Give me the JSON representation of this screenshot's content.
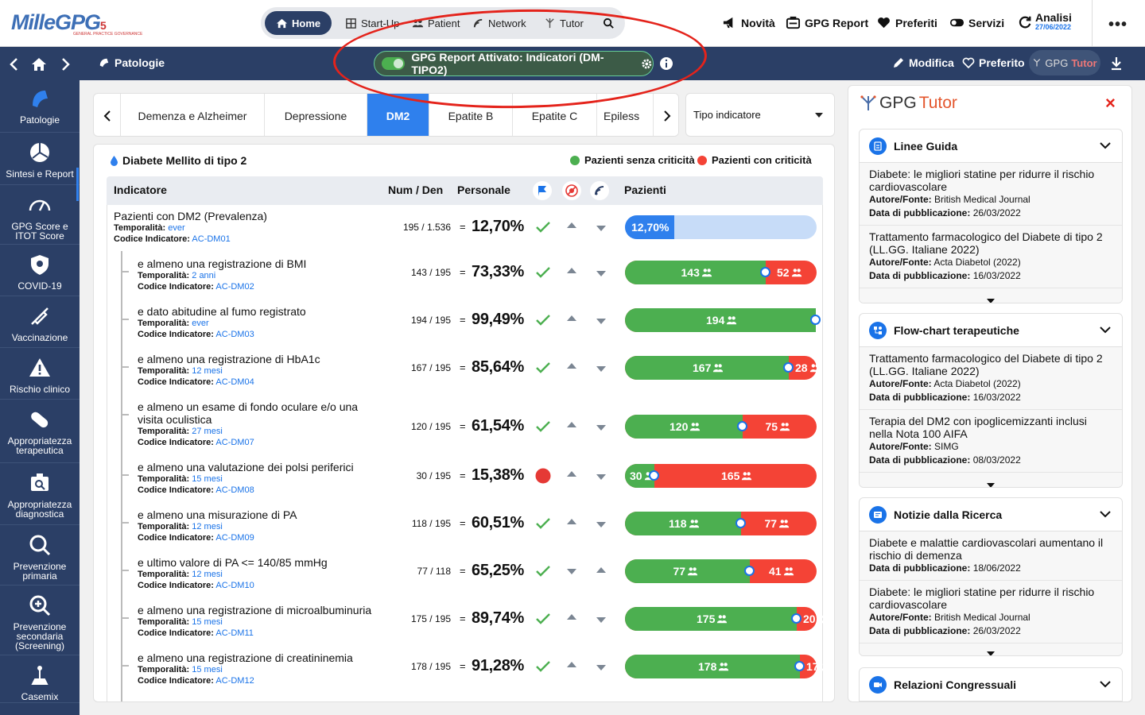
{
  "app": {
    "logo_text": "MilleGPG",
    "logo_sub": "GENERAL PRACTICE GOVERNANCE",
    "logo_badge": "5"
  },
  "topnav": {
    "tabs": [
      {
        "label": "Home",
        "icon": "home-icon",
        "active": true
      },
      {
        "label": "Start-Up",
        "icon": "grid-icon"
      },
      {
        "label": "Patient",
        "icon": "users-icon"
      },
      {
        "label": "Network",
        "icon": "network-icon"
      },
      {
        "label": "Tutor",
        "icon": "tutor-icon"
      }
    ],
    "search_icon": "search-icon",
    "right": [
      {
        "label": "Novità",
        "icon": "megaphone-icon"
      },
      {
        "label": "GPG Report",
        "icon": "report-icon"
      },
      {
        "label": "Preferiti",
        "icon": "heart-icon"
      },
      {
        "label": "Servizi",
        "icon": "toggle-icon"
      }
    ],
    "analisi": {
      "label": "Analisi",
      "date": "27/06/2022"
    },
    "more_label": "•••"
  },
  "secbar": {
    "section": "Patologie",
    "report_pill": "GPG Report Attivato: Indicatori (DM-TIPO2)",
    "report_enabled": true,
    "modifica": "Modifica",
    "preferito": "Preferito",
    "tutor_gpg": "GPG",
    "tutor_name": "Tutor"
  },
  "sidebar": {
    "items": [
      {
        "label": "Patologie",
        "icon": "patologie-icon",
        "active": true
      },
      {
        "label": "Sintesi e Report",
        "icon": "pie-chart-icon"
      },
      {
        "label": "GPG Score e ITOT Score",
        "icon": "gauge-icon"
      },
      {
        "label": "COVID-19",
        "icon": "shield-icon"
      },
      {
        "label": "Vaccinazione",
        "icon": "syringe-icon"
      },
      {
        "label": "Rischio clinico",
        "icon": "warning-icon"
      },
      {
        "label": "Appropriatezza terapeutica",
        "icon": "pill-icon"
      },
      {
        "label": "Appropriatezza diagnostica",
        "icon": "diagnostic-icon"
      },
      {
        "label": "Prevenzione primaria",
        "icon": "magnifier-icon"
      },
      {
        "label": "Prevenzione secondaria (Screening)",
        "icon": "zoom-plus-icon"
      },
      {
        "label": "Casemix",
        "icon": "scale-icon"
      }
    ]
  },
  "disease_tabs": {
    "items": [
      "Demenza e Alzheimer",
      "Depressione",
      "DM2",
      "Epatite B",
      "Epatite C",
      "Epiless"
    ],
    "active": "DM2",
    "filter_label": "Tipo indicatore"
  },
  "panel": {
    "title": "Diabete Mellito di tipo 2",
    "legend_ok": "Pazienti senza criticità",
    "legend_ko": "Pazienti con criticità",
    "colors": {
      "ok": "#4caf50",
      "ko": "#f44336",
      "accent": "#2f80ed"
    },
    "headers": {
      "indicatore": "Indicatore",
      "numden": "Num / Den",
      "personale": "Personale",
      "pazienti": "Pazienti",
      "icon1": "flag-icon",
      "icon2": "no-virus-icon",
      "icon3": "network-badge-icon"
    },
    "lbl_temporalita": "Temporalità:",
    "lbl_codice": "Codice Indicatore:",
    "eq": "=",
    "rows": [
      {
        "name": "Pazienti con DM2 (Prevalenza)",
        "temporalita": "ever",
        "codice": "AC-DM01",
        "num": "195",
        "den": "1.536",
        "frac": "195 / 1.536",
        "pct": "12,70%",
        "status": "check",
        "trend": "up-down",
        "type": "prevalence",
        "fill": 0.127
      },
      {
        "name": "e almeno una registrazione di BMI",
        "temporalita": "2 anni",
        "codice": "AC-DM02",
        "frac": "143 / 195",
        "pct": "73,33%",
        "status": "check",
        "trend": "up-down",
        "ok": "143",
        "ko": "52",
        "fill": 0.7333
      },
      {
        "name": "e dato abitudine al fumo registrato",
        "temporalita": "ever",
        "codice": "AC-DM03",
        "frac": "194 / 195",
        "pct": "99,49%",
        "status": "check",
        "trend": "up-down",
        "ok": "194",
        "ko": "1",
        "fill": 0.9949
      },
      {
        "name": "e almeno una registrazione di HbA1c",
        "temporalita": "12 mesi",
        "codice": "AC-DM04",
        "frac": "167 / 195",
        "pct": "85,64%",
        "status": "check",
        "trend": "up-down",
        "ok": "167",
        "ko": "28",
        "fill": 0.8564
      },
      {
        "name": "e almeno un esame di fondo oculare e/o una visita oculistica",
        "name_l1": "e almeno un esame di fondo oculare e/o una",
        "name_l2": "visita oculistica",
        "temporalita": "27 mesi",
        "codice": "AC-DM07",
        "frac": "120 / 195",
        "pct": "61,54%",
        "status": "check",
        "trend": "up-down",
        "ok": "120",
        "ko": "75",
        "fill": 0.6154
      },
      {
        "name": "e almeno una valutazione dei polsi periferici",
        "temporalita": "15 mesi",
        "codice": "AC-DM08",
        "frac": "30 / 195",
        "pct": "15,38%",
        "status": "alert",
        "trend": "up-down",
        "ok": "30",
        "ko": "165",
        "fill": 0.1538
      },
      {
        "name": "e almeno una misurazione di PA",
        "temporalita": "12 mesi",
        "codice": "AC-DM09",
        "frac": "118 / 195",
        "pct": "60,51%",
        "status": "check",
        "trend": "up-down",
        "ok": "118",
        "ko": "77",
        "fill": 0.6051
      },
      {
        "name": "e ultimo valore di PA <= 140/85 mmHg",
        "temporalita": "12 mesi",
        "codice": "AC-DM10",
        "frac": "77 / 118",
        "pct": "65,25%",
        "status": "check",
        "trend": "down-up",
        "ok": "77",
        "ko": "41",
        "fill": 0.6525
      },
      {
        "name": "e almeno una registrazione di microalbuminuria",
        "temporalita": "15 mesi",
        "codice": "AC-DM11",
        "frac": "175 / 195",
        "pct": "89,74%",
        "status": "check",
        "trend": "up-down",
        "ok": "175",
        "ko": "20",
        "fill": 0.8974
      },
      {
        "name": "e almeno una registrazione di creatininemia",
        "temporalita": "15 mesi",
        "codice": "AC-DM12",
        "frac": "178 / 195",
        "pct": "91,28%",
        "status": "check",
        "trend": "up-down",
        "ok": "178",
        "ko": "17",
        "fill": 0.9128
      }
    ]
  },
  "tutor": {
    "logo_gpg": "GPG",
    "logo_tutor": "Tutor",
    "close_label": "×",
    "lbl_autore": "Autore/Fonte:",
    "lbl_data": "Data di pubblicazione:",
    "cards": [
      {
        "title": "Linee Guida",
        "icon": "document-icon",
        "items": [
          {
            "title": "Diabete: le migliori statine per ridurre il rischio cardiovascolare",
            "autore": "British Medical Journal",
            "data": "26/03/2022"
          },
          {
            "title": "Trattamento farmacologico del Diabete di tipo 2 (LL.GG. Italiane 2022)",
            "autore": "Acta Diabetol (2022)",
            "data": "16/03/2022"
          }
        ]
      },
      {
        "title": "Flow-chart terapeutiche",
        "icon": "flowchart-icon",
        "items": [
          {
            "title": "Trattamento farmacologico del Diabete di tipo 2 (LL.GG. Italiane 2022)",
            "autore": "Acta Diabetol (2022)",
            "data": "16/03/2022"
          },
          {
            "title": "Terapia del DM2 con ipoglicemizzanti inclusi nella Nota 100 AIFA",
            "autore": "SIMG",
            "data": "08/03/2022"
          }
        ]
      },
      {
        "title": "Notizie dalla Ricerca",
        "icon": "news-icon",
        "items": [
          {
            "title": "Diabete e malattie cardiovascolari aumentano il rischio di demenza",
            "data": "18/06/2022"
          },
          {
            "title": "Diabete: le migliori statine per ridurre il rischio cardiovascolare",
            "autore": "British Medical Journal",
            "data": "26/03/2022"
          }
        ]
      },
      {
        "title": "Relazioni Congressuali",
        "icon": "video-icon",
        "items": []
      }
    ]
  }
}
